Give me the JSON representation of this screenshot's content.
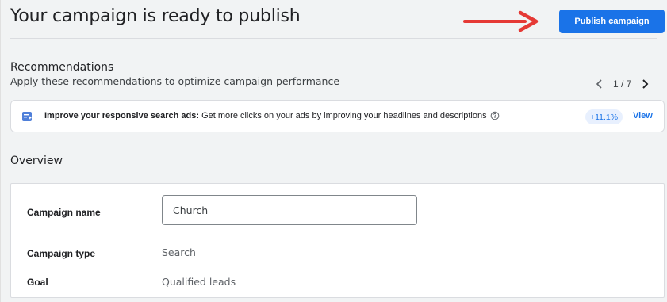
{
  "header": {
    "title": "Your campaign is ready to publish",
    "publish_label": "Publish campaign"
  },
  "recommendations": {
    "title": "Recommendations",
    "subtitle": "Apply these recommendations to optimize campaign performance",
    "pager": "1 / 7",
    "card": {
      "bold_text": "Improve your responsive search ads:",
      "text": " Get more clicks on your ads by improving your headlines and descriptions",
      "uplift": "+11.1%",
      "view_label": "View"
    }
  },
  "overview": {
    "title": "Overview",
    "campaign_name_label": "Campaign name",
    "campaign_name_value": "Church",
    "campaign_type_label": "Campaign type",
    "campaign_type_value": "Search",
    "goal_label": "Goal",
    "goal_value": "Qualified leads"
  },
  "colors": {
    "accent": "#1a73e8",
    "arrow": "#e53935",
    "background": "#f1f3f4"
  },
  "icons": [
    "arrow-right-icon",
    "chevron-left-icon",
    "chevron-right-icon",
    "recommendation-icon",
    "help-icon"
  ]
}
